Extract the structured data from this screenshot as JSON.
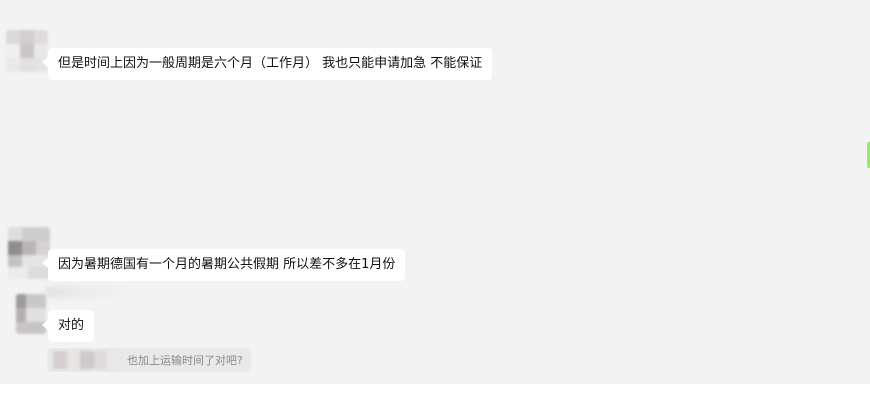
{
  "messages": [
    {
      "text": "但是时间上因为一般周期是六个月（工作月） 我也只能申请加急 不能保证"
    },
    {
      "text": "因为暑期德国有一个月的暑期公共假期 所以差不多在1月份"
    },
    {
      "text": "对的"
    }
  ],
  "quote": {
    "text": "也加上运输时间了对吧?"
  },
  "colors": {
    "chat_bg": "#f3f3f3",
    "bubble_bg": "#ffffff",
    "self_bubble_edge": "#95ec69"
  }
}
